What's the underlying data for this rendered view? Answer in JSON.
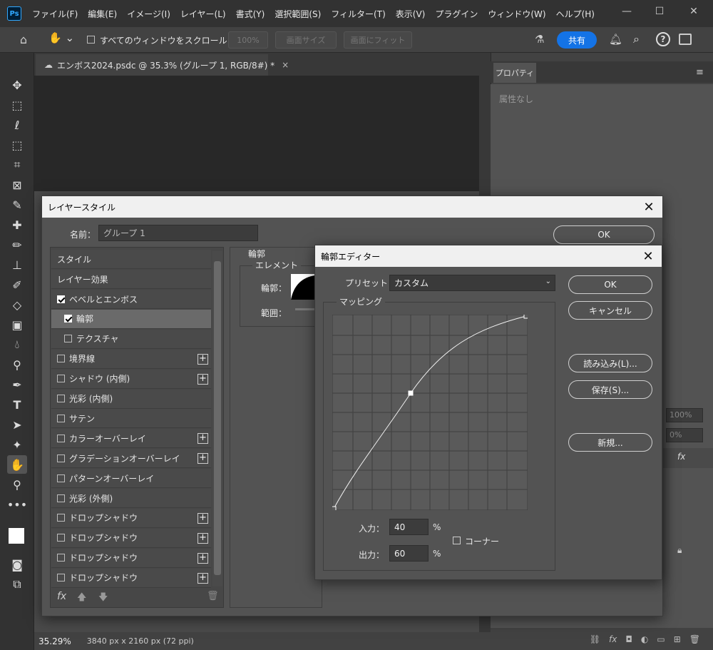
{
  "app": {
    "logo": "Ps",
    "menus": [
      "ファイル(F)",
      "編集(E)",
      "イメージ(I)",
      "レイヤー(L)",
      "書式(Y)",
      "選択範囲(S)",
      "フィルター(T)",
      "表示(V)",
      "プラグイン",
      "ウィンドウ(W)",
      "ヘルプ(H)"
    ]
  },
  "options": {
    "scroll_all_label": "すべてのウィンドウをスクロール",
    "zoom_100": "100%",
    "fit_screen": "画面サイズ",
    "fill_screen": "画面にフィット",
    "share": "共有"
  },
  "document": {
    "tab_title": "エンボス2024.psdc @ 35.3% (グループ 1, RGB/8#) *",
    "zoom": "35.29%",
    "doc_info": "3840 px x 2160 px (72 ppi)"
  },
  "properties": {
    "tab": "プロパティ",
    "empty": "属性なし"
  },
  "layers_partial": {
    "opacity": "100%",
    "fill": "0%",
    "fx": "fx"
  },
  "layer_style": {
    "title": "レイヤースタイル",
    "name_label": "名前：",
    "name_value": "グループ 1",
    "ok": "OK",
    "style_header": "スタイル",
    "effects_header": "レイヤー効果",
    "items": [
      {
        "label": "ベベルとエンボス",
        "checked": true,
        "plus": false
      },
      {
        "label": "輪郭",
        "checked": true,
        "plus": false
      },
      {
        "label": "テクスチャ",
        "checked": false,
        "plus": false
      },
      {
        "label": "境界線",
        "checked": false,
        "plus": true
      },
      {
        "label": "シャドウ (内側)",
        "checked": false,
        "plus": true
      },
      {
        "label": "光彩 (内側)",
        "checked": false,
        "plus": false
      },
      {
        "label": "サテン",
        "checked": false,
        "plus": false
      },
      {
        "label": "カラーオーバーレイ",
        "checked": false,
        "plus": true
      },
      {
        "label": "グラデーションオーバーレイ",
        "checked": false,
        "plus": true
      },
      {
        "label": "パターンオーバーレイ",
        "checked": false,
        "plus": false
      },
      {
        "label": "光彩 (外側)",
        "checked": false,
        "plus": false
      },
      {
        "label": "ドロップシャドウ",
        "checked": false,
        "plus": true
      },
      {
        "label": "ドロップシャドウ",
        "checked": false,
        "plus": true
      },
      {
        "label": "ドロップシャドウ",
        "checked": false,
        "plus": true
      },
      {
        "label": "ドロップシャドウ",
        "checked": false,
        "plus": true
      }
    ],
    "section_title": "輪郭",
    "element_group": "エレメント",
    "contour_label": "輪郭：",
    "range_label": "範囲："
  },
  "contour_editor": {
    "title": "輪郭エディター",
    "preset_label": "プリセット：",
    "preset_value": "カスタム",
    "mapping": "マッピング",
    "input_label": "入力：",
    "input_value": "40",
    "output_label": "出力：",
    "output_value": "60",
    "percent": "%",
    "corner_label": "コーナー",
    "ok": "OK",
    "cancel": "キャンセル",
    "load": "読み込み(L)...",
    "save": "保存(S)...",
    "new": "新規...",
    "curve_points": [
      [
        0,
        0
      ],
      [
        40,
        60
      ],
      [
        100,
        100
      ]
    ]
  }
}
